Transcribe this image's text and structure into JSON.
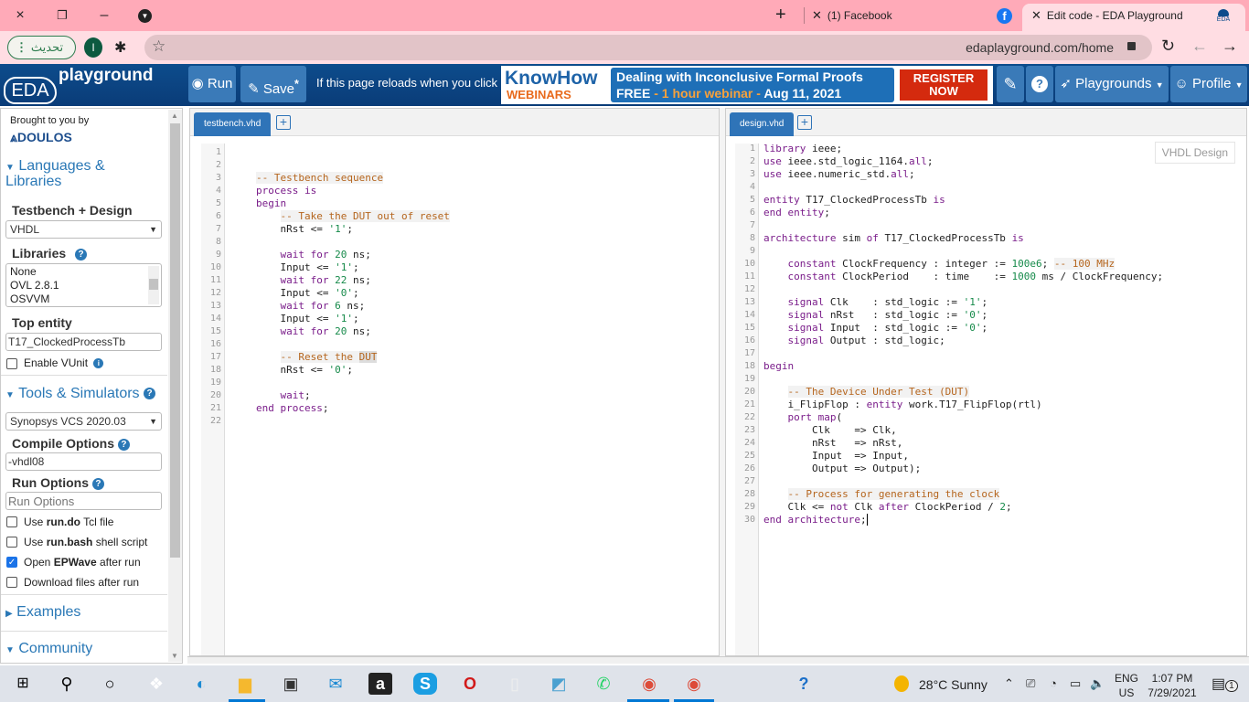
{
  "browser": {
    "window_controls": {
      "close": "×",
      "restore": "❐",
      "minimize": "–"
    },
    "new_tab": "+",
    "tabs": [
      {
        "title": "(1) Facebook",
        "icon": "facebook-icon"
      },
      {
        "title": "Edit code - EDA Playground",
        "icon": "eda-cloud-icon",
        "active": true
      }
    ],
    "update_button": "تحديث",
    "profile_initial": "I",
    "url": "edaplayground.com/home"
  },
  "app": {
    "logo_text": "playground",
    "logo_badge": "EDA",
    "run_label": "Run",
    "save_label": "Save",
    "save_marker": "*",
    "reload_message": "If this page reloads when you click 'Run'",
    "banner": {
      "brand_top": "KnowHow",
      "brand_bottom": "WEBINARS",
      "line1": "Dealing with Inconclusive Formal Proofs",
      "line2_free": "FREE",
      "line2_mid": "1 hour webinar",
      "line2_date": "Aug 11, 2021",
      "cta_line1": "REGISTER",
      "cta_line2": "NOW"
    },
    "playgrounds_label": "Playgrounds",
    "profile_label": "Profile"
  },
  "sidebar": {
    "brought_by": "Brought to you by",
    "sponsor": "DOULOS",
    "languages_heading_1": "Languages &",
    "languages_heading_2": "Libraries",
    "testbench_label": "Testbench + Design",
    "testbench_value": "VHDL",
    "libraries_label": "Libraries",
    "libraries": [
      "None",
      "OVL 2.8.1",
      "OSVVM"
    ],
    "top_entity_label": "Top entity",
    "top_entity_value": "T17_ClockedProcessTb",
    "enable_vunit": "Enable VUnit",
    "tools_heading": "Tools & Simulators",
    "simulator_value": "Synopsys VCS 2020.03",
    "compile_label": "Compile Options",
    "compile_value": "-vhdl08",
    "run_options_label": "Run Options",
    "run_options_placeholder": "Run Options",
    "checkboxes": [
      {
        "pre": "Use ",
        "bold": "run.do",
        "post": " Tcl file",
        "checked": false
      },
      {
        "pre": "Use ",
        "bold": "run.bash",
        "post": " shell script",
        "checked": false
      },
      {
        "pre": "Open ",
        "bold": "EPWave",
        "post": " after run",
        "checked": true
      },
      {
        "pre": "Download files after run",
        "bold": "",
        "post": "",
        "checked": false
      }
    ],
    "examples_heading": "Examples",
    "community_heading": "Community"
  },
  "testbench": {
    "filename": "testbench.vhd",
    "line_count": 22
  },
  "design": {
    "filename": "design.vhd",
    "language_tag": "VHDL Design",
    "line_count": 30
  },
  "taskbar": {
    "weather_temp": "28°C",
    "weather_desc": "Sunny",
    "lang_top": "ENG",
    "lang_bottom": "US",
    "time": "1:07 PM",
    "date": "7/29/2021",
    "notifications": "1"
  }
}
